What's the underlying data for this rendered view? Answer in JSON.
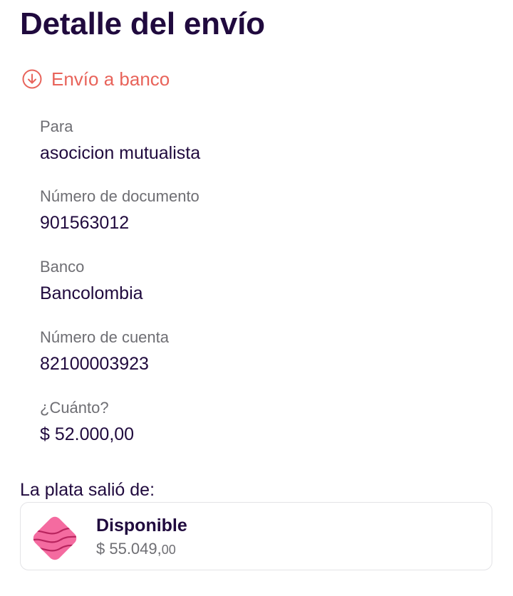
{
  "header": {
    "title": "Detalle del envío"
  },
  "transfer": {
    "type_label": "Envío a banco",
    "type_icon": "arrow-down-circle-icon",
    "accent_color": "#e8635a"
  },
  "fields": [
    {
      "label": "Para",
      "value": "asocicion mutualista"
    },
    {
      "label": "Número de documento",
      "value": "901563012"
    },
    {
      "label": "Banco",
      "value": "Bancolombia"
    },
    {
      "label": "Número de cuenta",
      "value": "82100003923"
    },
    {
      "label": "¿Cuánto?",
      "value": "$ 52.000,00"
    }
  ],
  "source": {
    "heading": "La plata salió de:",
    "pocket": {
      "name": "Disponible",
      "amount_main": "$ 55.049,",
      "amount_cents": "00",
      "icon": "pink-wave-tile-icon",
      "icon_color": "#f46ba0"
    }
  },
  "colors": {
    "title": "#200a3e",
    "label": "#6e6e73",
    "card_border": "#e3e3e6"
  }
}
